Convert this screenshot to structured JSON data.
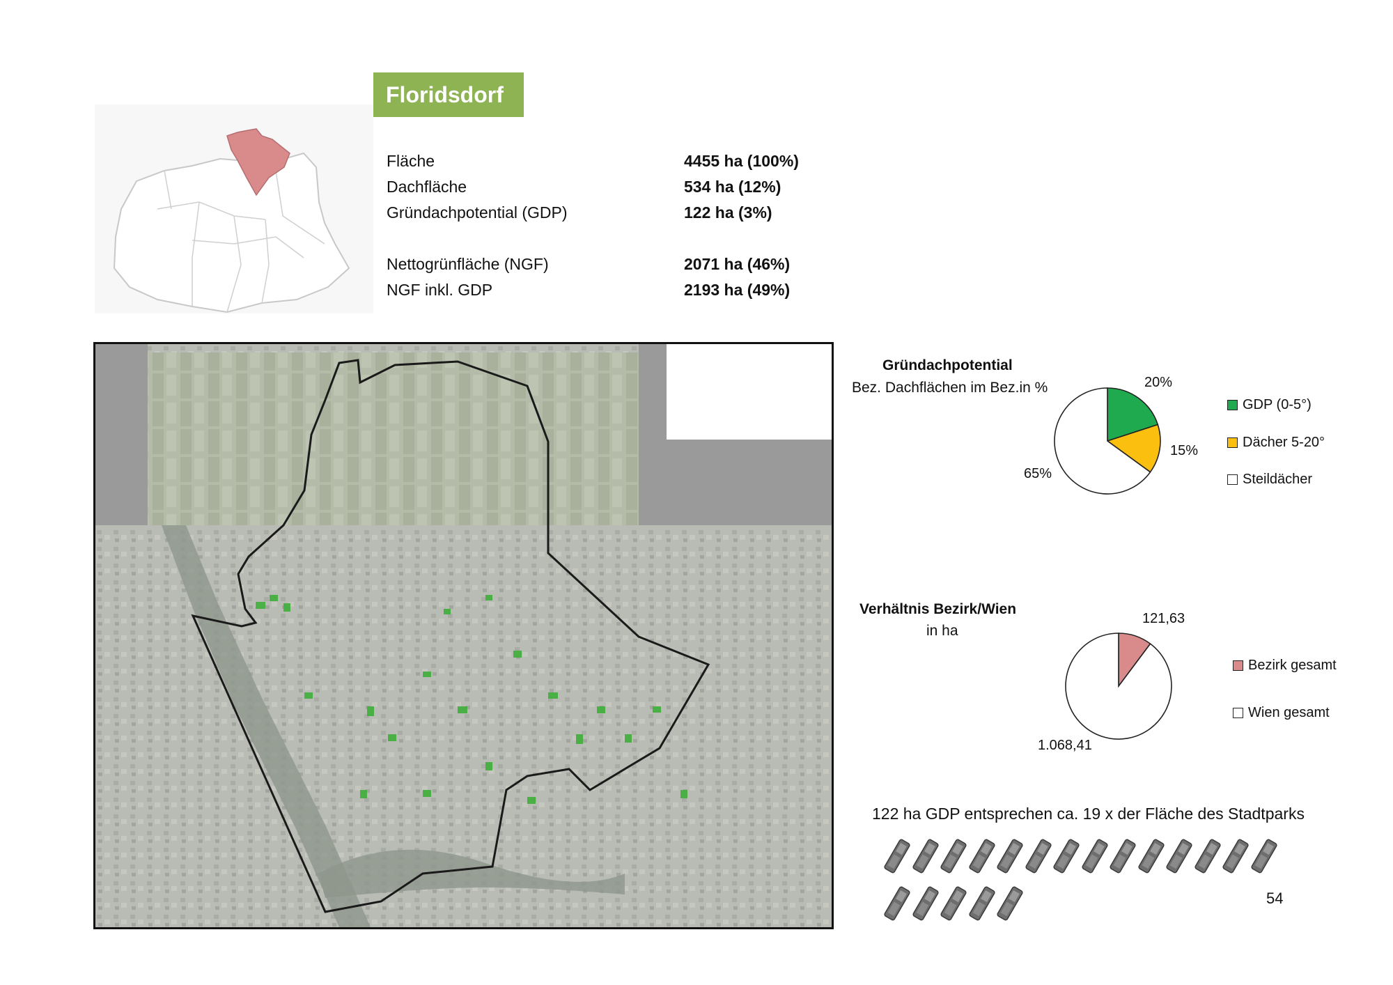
{
  "district": {
    "title": "Floridsdorf",
    "highlight_color": "#d98b8c"
  },
  "stats": [
    {
      "label": "Fläche",
      "value": "4455 ha (100%)"
    },
    {
      "label": "Dachfläche",
      "value": "534 ha (12%)"
    },
    {
      "label": "Gründachpotential (GDP)",
      "value": "122 ha (3%)"
    },
    {
      "label": "Nettogrünfläche (NGF)",
      "value": "2071 ha (46%)"
    },
    {
      "label": "NGF inkl. GDP",
      "value": "2193 ha (49%)"
    }
  ],
  "chart_data": [
    {
      "type": "pie",
      "title": "Gründachpotential",
      "subtitle": "Bez. Dachflächen im Bez.in %",
      "categories": [
        "GDP (0-5°)",
        "Dächer 5-20°",
        "Steildächer"
      ],
      "values": [
        20,
        15,
        65
      ],
      "labels": [
        "20%",
        "15%",
        "65%"
      ],
      "colors": [
        "#1faa4f",
        "#fbbf10",
        "#ffffff"
      ],
      "legend": "right"
    },
    {
      "type": "pie",
      "title": "Verhältnis Bezirk/Wien",
      "subtitle": "in ha",
      "categories": [
        "Bezirk gesamt",
        "Wien gesamt"
      ],
      "values": [
        121.63,
        1068.41
      ],
      "labels": [
        "121,63",
        "1.068,41"
      ],
      "colors": [
        "#d98b8c",
        "#ffffff"
      ],
      "legend": "right"
    }
  ],
  "comparison": {
    "text": "122 ha GDP entsprechen  ca. 19 x der Fläche des Stadtparks",
    "count": 19,
    "icon": "park-icon"
  },
  "page_number": "54"
}
